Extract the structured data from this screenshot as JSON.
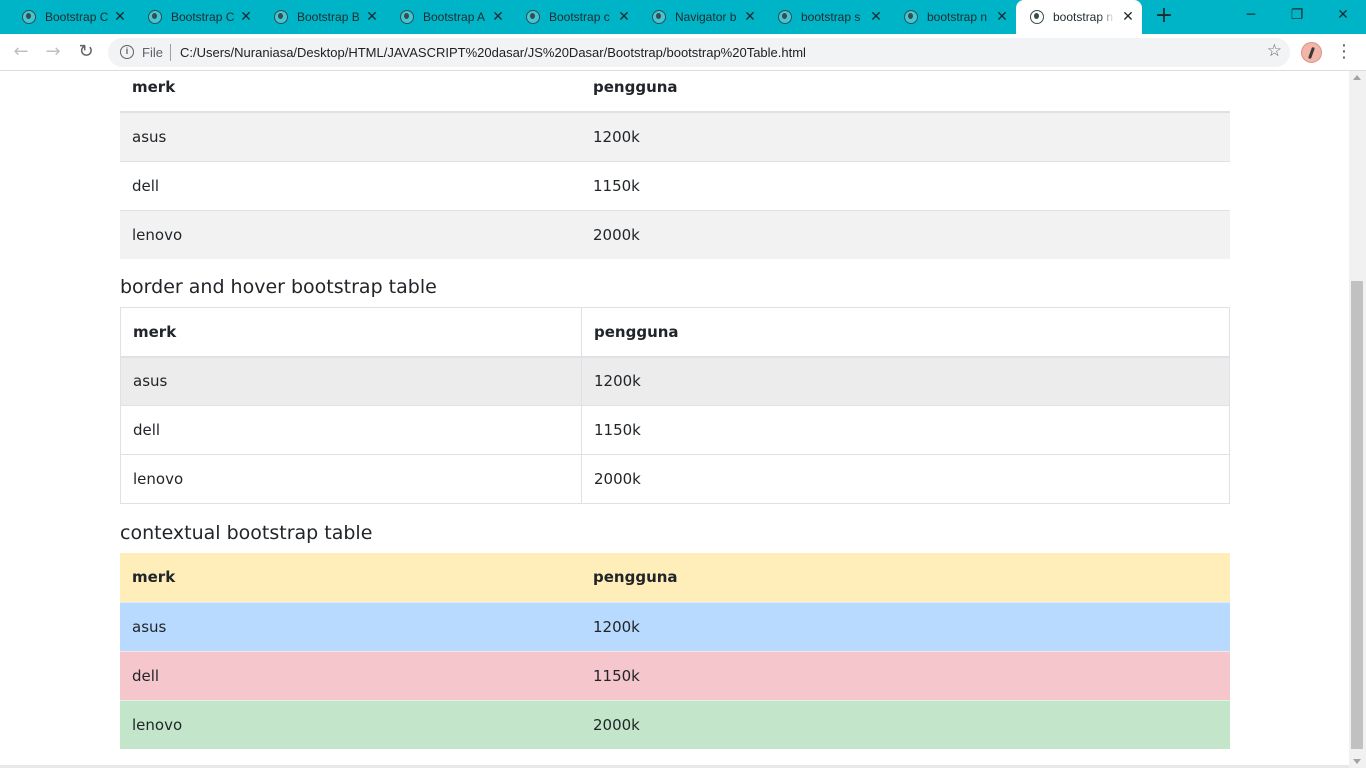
{
  "browser": {
    "tabs": [
      {
        "title": "Bootstrap C"
      },
      {
        "title": "Bootstrap C"
      },
      {
        "title": "Bootstrap B"
      },
      {
        "title": "Bootstrap A"
      },
      {
        "title": "Bootstrap c"
      },
      {
        "title": "Navigator b"
      },
      {
        "title": "bootstrap s"
      },
      {
        "title": "bootstrap n"
      },
      {
        "title": "bootstrap n"
      }
    ],
    "active_tab_index": 8,
    "new_tab_glyph": "+",
    "file_label": "File",
    "url": "C:/Users/Nuraniasa/Desktop/HTML/JAVASCRIPT%20dasar/JS%20Dasar/Bootstrap/bootstrap%20Table.html",
    "accent_color": "#00b4c8"
  },
  "page": {
    "striped_table": {
      "headers": [
        "merk",
        "pengguna"
      ],
      "rows": [
        [
          "asus",
          "1200k"
        ],
        [
          "dell",
          "1150k"
        ],
        [
          "lenovo",
          "2000k"
        ]
      ]
    },
    "bordered_heading": "border and hover bootstrap table",
    "bordered_table": {
      "headers": [
        "merk",
        "pengguna"
      ],
      "rows": [
        [
          "asus",
          "1200k"
        ],
        [
          "dell",
          "1150k"
        ],
        [
          "lenovo",
          "2000k"
        ]
      ]
    },
    "contextual_heading": "contextual bootstrap table",
    "contextual_table": {
      "headers": [
        "merk",
        "pengguna"
      ],
      "rows": [
        [
          "asus",
          "1200k"
        ],
        [
          "dell",
          "1150k"
        ],
        [
          "lenovo",
          "2000k"
        ]
      ]
    }
  }
}
